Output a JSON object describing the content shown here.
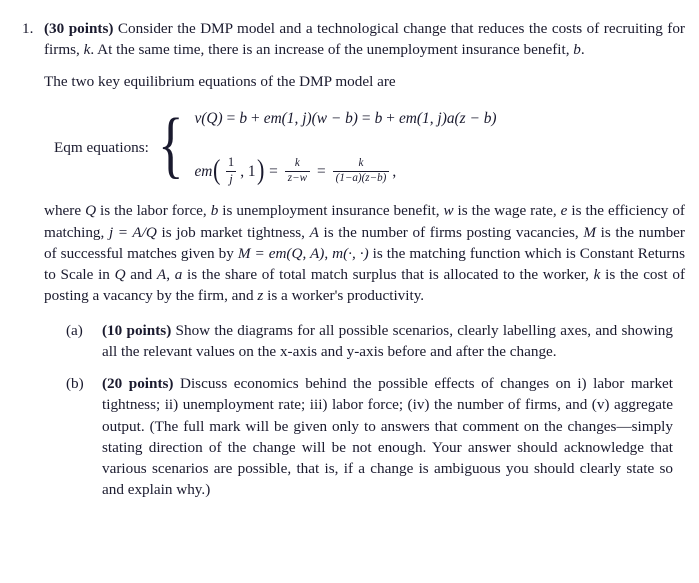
{
  "document": {
    "problem_number": "1.",
    "points_label": "(30 points)",
    "intro_text_1": " Consider the DMP model and a technological change that reduces the costs of recruiting for firms, ",
    "intro_var_k": "k",
    "intro_text_2": ". At the same time, there is an increase of the unemployment insurance benefit, ",
    "intro_var_b": "b",
    "intro_text_3": ".",
    "lead_in": "The two key equilibrium equations of the DMP model are",
    "equations": {
      "label": "Eqm equations:",
      "brace": "{",
      "row1": {
        "lhs": "v(Q)",
        "eq1": "=",
        "term1": "b",
        "plus1": "+",
        "term2": "em(1, j)(w − b)",
        "eq2": "=",
        "term3": "b",
        "plus2": "+",
        "term4": "em(1, j)a(z − b)",
        "plain": "v(Q) = b + em(1, j)(w − b) = b + em(1, j)a(z − b)"
      },
      "row2": {
        "func": "em",
        "paren_open": "(",
        "arg_num": "1",
        "arg_den": "j",
        "arg_comma": ", 1",
        "paren_close": ")",
        "eq1": "=",
        "frac1_num": "k",
        "frac1_den": "z−w",
        "eq2": "=",
        "frac2_num": "k",
        "frac2_den": "(1−a)(z−b)",
        "trailing_comma": ",",
        "plain": "em (1/j, 1) = k/(z−w) = k/((1−a)(z−b)),"
      }
    },
    "where_paragraph": {
      "plain": "where Q is the labor force, b is unemployment insurance benefit, w is the wage rate, e is the efficiency of matching, j = A/Q is job market tightness, A is the number of firms posting vacancies, M is the number of successful matches given by M = em(Q, A), m(·, ·) is the matching function which is Constant Returns to Scale in Q and A, a is the share of total match surplus that is allocated to the worker, k is the cost of posting a vacancy by the firm, and z is a worker's productivity.",
      "segments": [
        {
          "t": "where ",
          "i": false
        },
        {
          "t": "Q",
          "i": true
        },
        {
          "t": " is the labor force, ",
          "i": false
        },
        {
          "t": "b",
          "i": true
        },
        {
          "t": " is unemployment insurance benefit, ",
          "i": false
        },
        {
          "t": "w",
          "i": true
        },
        {
          "t": " is the wage rate, ",
          "i": false
        },
        {
          "t": "e",
          "i": true
        },
        {
          "t": " is the efficiency of matching, ",
          "i": false
        },
        {
          "t": "j = A/Q",
          "i": true
        },
        {
          "t": " is job market tightness, ",
          "i": false
        },
        {
          "t": "A",
          "i": true
        },
        {
          "t": " is the number of firms posting vacancies, ",
          "i": false
        },
        {
          "t": "M",
          "i": true
        },
        {
          "t": " is the number of successful matches given by ",
          "i": false
        },
        {
          "t": "M = em(Q, A)",
          "i": true
        },
        {
          "t": ", ",
          "i": false
        },
        {
          "t": "m(·, ·)",
          "i": true
        },
        {
          "t": " is the matching function which is Constant Returns to Scale in ",
          "i": false
        },
        {
          "t": "Q",
          "i": true
        },
        {
          "t": " and ",
          "i": false
        },
        {
          "t": "A",
          "i": true
        },
        {
          "t": ", ",
          "i": false
        },
        {
          "t": "a",
          "i": true
        },
        {
          "t": " is the share of total match surplus that is allocated to the worker, ",
          "i": false
        },
        {
          "t": "k",
          "i": true
        },
        {
          "t": " is the cost of posting a vacancy by the firm, and ",
          "i": false
        },
        {
          "t": "z",
          "i": true
        },
        {
          "t": " is a worker's productivity.",
          "i": false
        }
      ]
    },
    "subparts": [
      {
        "label": "(a)",
        "points": "(10 points)",
        "text": " Show the diagrams for all possible scenarios, clearly labelling axes, and showing all the relevant values on the x-axis and y-axis before and after the change."
      },
      {
        "label": "(b)",
        "points": "(20 points)",
        "text": " Discuss economics behind the possible effects of changes on i) labor market tightness; ii) unemployment rate; iii) labor force; (iv) the number of firms, and (v) aggregate output. (The full mark will be given only to answers that comment on the changes—simply stating direction of the change will be not enough. Your answer should acknowledge that various scenarios are possible, that is, if a change is ambiguous you should clearly state so and explain why.)"
      }
    ]
  },
  "colors": {
    "text": "#1a1a2e",
    "background": "#ffffff"
  }
}
